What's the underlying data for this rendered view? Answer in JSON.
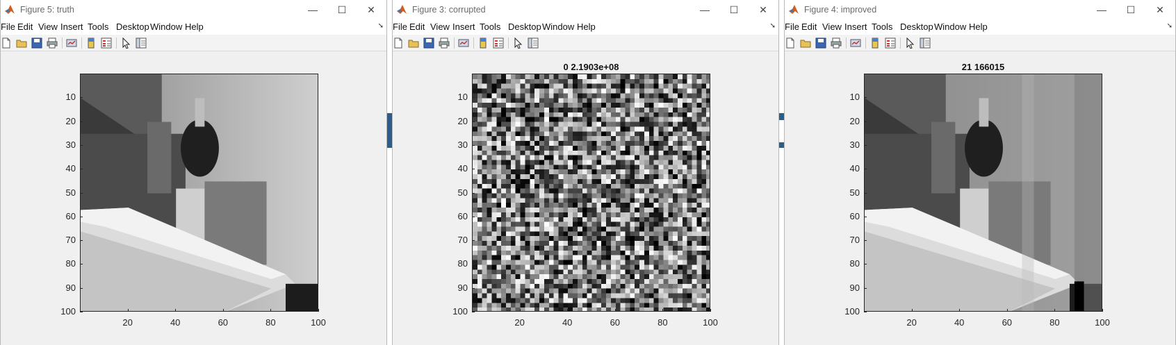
{
  "menu": [
    "File",
    "Edit",
    "View",
    "Insert",
    "Tools",
    "Desktop",
    "Window",
    "Help"
  ],
  "window_controls": {
    "minimize": "—",
    "maximize": "☐",
    "close": "✕"
  },
  "figures": [
    {
      "title": "Figure 5: truth",
      "plot_title": "",
      "image": "truth"
    },
    {
      "title": "Figure 3: corrupted",
      "plot_title": "0 2.1903e+08",
      "image": "corrupted"
    },
    {
      "title": "Figure 4: improved",
      "plot_title": "21 166015",
      "image": "improved"
    }
  ],
  "axes": {
    "y_ticks": [
      "10",
      "20",
      "30",
      "40",
      "50",
      "60",
      "70",
      "80",
      "90",
      "100"
    ],
    "x_ticks": [
      "20",
      "40",
      "60",
      "80",
      "100"
    ]
  },
  "toolbar_icons": [
    "new-figure-icon",
    "open-file-icon",
    "save-icon",
    "print-icon",
    "link-plot-icon",
    "colorbar-icon",
    "legend-icon",
    "edit-plot-icon",
    "property-inspector-icon"
  ],
  "colors": {
    "axes": "#262626",
    "window_bg": "#f0f0f0",
    "title_text": "#6b6b6b"
  }
}
